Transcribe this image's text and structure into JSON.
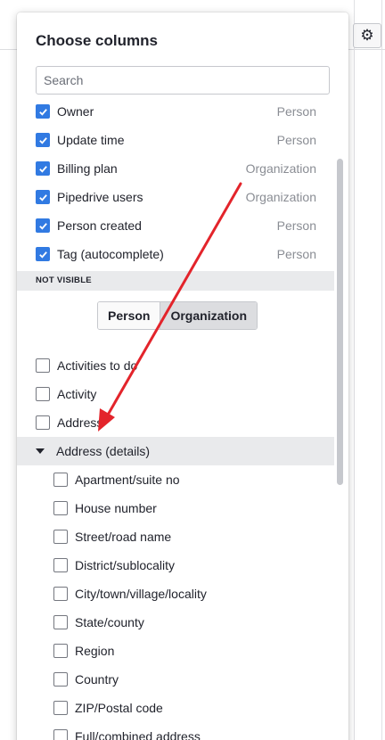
{
  "panel": {
    "title": "Choose columns",
    "search_placeholder": "Search"
  },
  "visible_columns": [
    {
      "label": "Owner",
      "type": "Person",
      "checked": true
    },
    {
      "label": "Update time",
      "type": "Person",
      "checked": true
    },
    {
      "label": "Billing plan",
      "type": "Organization",
      "checked": true
    },
    {
      "label": "Pipedrive users",
      "type": "Organization",
      "checked": true
    },
    {
      "label": "Person created",
      "type": "Person",
      "checked": true
    },
    {
      "label": "Tag (autocomplete)",
      "type": "Person",
      "checked": true
    }
  ],
  "not_visible": {
    "header": "NOT VISIBLE",
    "filter_tabs": [
      {
        "label": "Person",
        "active": false
      },
      {
        "label": "Organization",
        "active": true
      }
    ],
    "items": [
      {
        "label": "Activities to do",
        "checked": false
      },
      {
        "label": "Activity",
        "checked": false
      },
      {
        "label": "Address",
        "checked": false
      }
    ],
    "group": {
      "label": "Address (details)",
      "expanded": true,
      "items": [
        {
          "label": "Apartment/suite no",
          "checked": false
        },
        {
          "label": "House number",
          "checked": false
        },
        {
          "label": "Street/road name",
          "checked": false
        },
        {
          "label": "District/sublocality",
          "checked": false
        },
        {
          "label": "City/town/village/locality",
          "checked": false
        },
        {
          "label": "State/county",
          "checked": false
        },
        {
          "label": "Region",
          "checked": false
        },
        {
          "label": "Country",
          "checked": false
        },
        {
          "label": "ZIP/Postal code",
          "checked": false
        },
        {
          "label": "Full/combined address",
          "checked": false
        }
      ]
    }
  },
  "toolbar": {
    "settings_icon": "gear-icon"
  },
  "colors": {
    "checkbox_checked": "#317ae2",
    "annotation_arrow": "#e3242b",
    "section_bg": "#e9eaec",
    "type_text": "#8a8d94"
  }
}
